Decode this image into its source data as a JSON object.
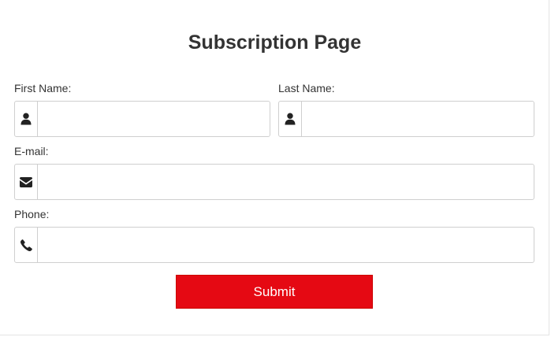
{
  "page": {
    "title": "Subscription Page"
  },
  "form": {
    "first_name": {
      "label": "First Name:",
      "value": "",
      "placeholder": "",
      "icon": "user-icon"
    },
    "last_name": {
      "label": "Last Name:",
      "value": "",
      "placeholder": "",
      "icon": "user-icon"
    },
    "email": {
      "label": "E-mail:",
      "value": "",
      "placeholder": "",
      "icon": "envelope-icon"
    },
    "phone": {
      "label": "Phone:",
      "value": "",
      "placeholder": "",
      "icon": "phone-icon"
    },
    "submit_label": "Submit"
  },
  "colors": {
    "submit_background": "#e50913",
    "submit_text": "#ffffff",
    "icon": "#222222",
    "border": "#cfcfcf"
  }
}
